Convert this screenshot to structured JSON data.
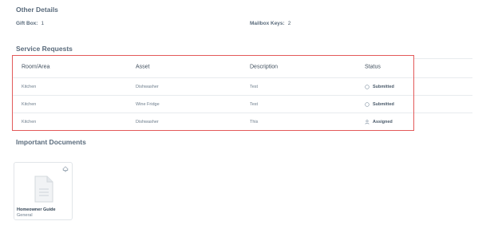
{
  "other_details": {
    "title": "Other Details",
    "gift_box_label": "Gift Box:",
    "gift_box_value": "1",
    "mailbox_keys_label": "Mailbox Keys:",
    "mailbox_keys_value": "2"
  },
  "service_requests": {
    "title": "Service Requests",
    "columns": [
      "Room/Area",
      "Asset",
      "Description",
      "Status"
    ],
    "rows": [
      {
        "room": "Kitchen",
        "asset": "Dishwasher",
        "description": "Test",
        "status": "Submitted",
        "status_icon": "circle-icon"
      },
      {
        "room": "Kitchen",
        "asset": "Wine Fridge",
        "description": "Test",
        "status": "Submitted",
        "status_icon": "circle-icon"
      },
      {
        "room": "Kitchen",
        "asset": "Dishwasher",
        "description": "This",
        "status": "Assigned",
        "status_icon": "user-icon"
      }
    ],
    "highlight_color": "#e35a5a"
  },
  "documents": {
    "title": "Important Documents",
    "items": [
      {
        "name": "Homeowner Guide",
        "category": "General",
        "icon": "document-icon",
        "action_icon": "share-icon"
      }
    ]
  }
}
